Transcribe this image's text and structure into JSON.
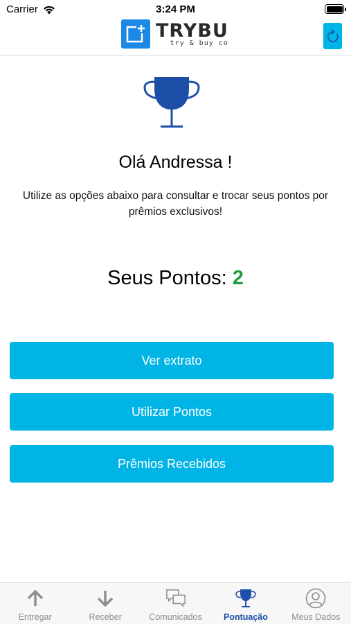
{
  "status_bar": {
    "carrier": "Carrier",
    "time": "3:24 PM"
  },
  "header": {
    "logo_title": "TRYBU",
    "logo_subtitle": "try & buy co",
    "refresh_icon": "refresh-icon"
  },
  "main": {
    "trophy_icon": "trophy-icon",
    "greeting": "Olá Andressa !",
    "description": "Utilize as opções abaixo para consultar e trocar seus pontos por prêmios exclusivos!",
    "points_label": "Seus Pontos:",
    "points_value": "2",
    "buttons": [
      {
        "label": "Ver extrato"
      },
      {
        "label": "Utilizar Pontos"
      },
      {
        "label": "Prêmios Recebidos"
      }
    ]
  },
  "tab_bar": {
    "items": [
      {
        "label": "Entregar",
        "icon": "arrow-up-icon",
        "active": false
      },
      {
        "label": "Receber",
        "icon": "arrow-down-icon",
        "active": false
      },
      {
        "label": "Comunicados",
        "icon": "chat-bubbles-icon",
        "active": false
      },
      {
        "label": "Pontuação",
        "icon": "trophy-icon",
        "active": true
      },
      {
        "label": "Meus Dados",
        "icon": "user-circle-icon",
        "active": false
      }
    ]
  },
  "colors": {
    "accent": "#00b4e6",
    "brand_blue": "#1e4fa8",
    "points_green": "#1e9b3c",
    "logo_blue": "#1e88e5",
    "tab_inactive": "#8e8e8e"
  }
}
